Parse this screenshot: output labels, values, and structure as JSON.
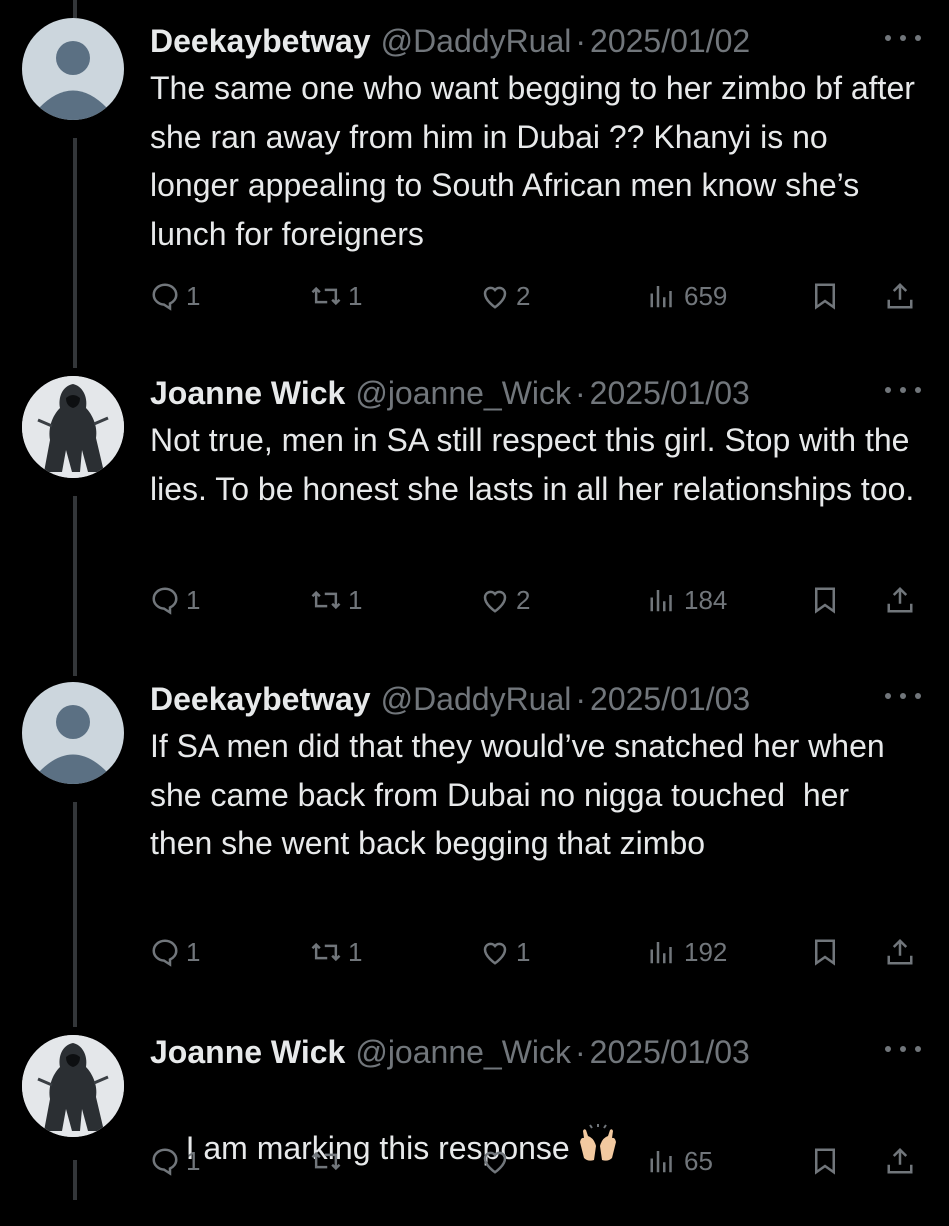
{
  "tweets": [
    {
      "name": "Deekaybetway",
      "handle": "@DaddyRual",
      "separator": "·",
      "date": "2025/01/02",
      "text": "The same one who want begging to her zimbo bf after she ran away from him in Dubai ?? Khanyi is no longer appealing to South African men know she’s lunch for foreigners",
      "avatar": "default-avatar",
      "replies": "1",
      "retweets": "1",
      "likes": "2",
      "views": "659"
    },
    {
      "name": "Joanne Wick",
      "handle": "@joanne_Wick",
      "separator": "·",
      "date": "2025/01/03",
      "text": "Not true, men in SA still respect this girl. Stop with the lies. To be honest she lasts in all her relationships too.",
      "avatar": "hooded-figure-avatar",
      "replies": "1",
      "retweets": "1",
      "likes": "2",
      "views": "184"
    },
    {
      "name": "Deekaybetway",
      "handle": "@DaddyRual",
      "separator": "·",
      "date": "2025/01/03",
      "text": "If SA men did that they would’ve snatched her when she came back from Dubai no nigga touched  her then she went back begging that zimbo",
      "avatar": "default-avatar",
      "replies": "1",
      "retweets": "1",
      "likes": "1",
      "views": "192"
    },
    {
      "name": "Joanne Wick",
      "handle": "@joanne_Wick",
      "separator": "·",
      "date": "2025/01/03",
      "text": "I am marking this response",
      "emoji": "raising-hands-emoji",
      "avatar": "hooded-figure-avatar",
      "replies": "1",
      "retweets": "",
      "likes": "",
      "views": "65"
    }
  ],
  "icons": {
    "reply": "reply-icon",
    "retweet": "retweet-icon",
    "like": "heart-icon",
    "views": "views-icon",
    "bookmark": "bookmark-icon",
    "share": "share-icon",
    "more": "more-icon"
  },
  "colors": {
    "background": "#000000",
    "text": "#e7e9ea",
    "secondary": "#71767b",
    "thread_line": "#333639"
  }
}
